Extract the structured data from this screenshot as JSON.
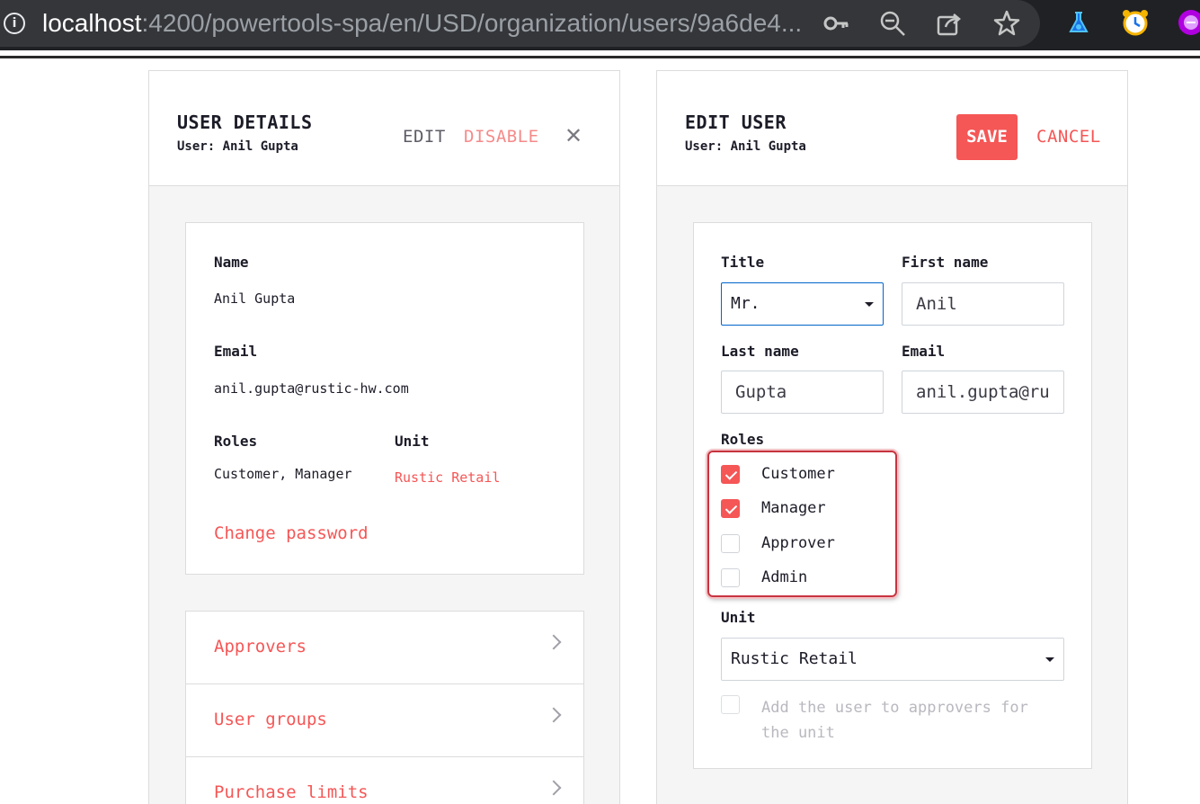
{
  "browser": {
    "url_host": "localhost",
    "url_path": ":4200/powertools-spa/en/USD/organization/users/9a6de4..."
  },
  "details": {
    "title": "USER DETAILS",
    "subtitle": "User: Anil Gupta",
    "edit_label": "EDIT",
    "disable_label": "DISABLE",
    "close_glyph": "✕",
    "name_label": "Name",
    "name_value": "Anil Gupta",
    "email_label": "Email",
    "email_value": "anil.gupta@rustic-hw.com",
    "roles_label": "Roles",
    "roles_value": "Customer, Manager",
    "unit_label": "Unit",
    "unit_value": "Rustic Retail",
    "change_password": "Change password",
    "nav": [
      {
        "label": "Approvers"
      },
      {
        "label": "User groups"
      },
      {
        "label": "Purchase limits"
      }
    ]
  },
  "edit": {
    "title": "EDIT USER",
    "subtitle": "User: Anil Gupta",
    "save_label": "SAVE",
    "cancel_label": "CANCEL",
    "title_label": "Title",
    "title_value": "Mr.",
    "first_name_label": "First name",
    "first_name_value": "Anil",
    "last_name_label": "Last name",
    "last_name_value": "Gupta",
    "email_label": "Email",
    "email_value": "anil.gupta@ru",
    "roles_label": "Roles",
    "roles": [
      {
        "label": "Customer",
        "checked": true
      },
      {
        "label": "Manager",
        "checked": true
      },
      {
        "label": "Approver",
        "checked": false
      },
      {
        "label": "Admin",
        "checked": false
      }
    ],
    "unit_label": "Unit",
    "unit_value": "Rustic Retail",
    "approver_text": "Add the user to approvers for the unit",
    "approver_checked": false
  },
  "colors": {
    "accent": "#f55656",
    "highlight": "#c7343f"
  }
}
